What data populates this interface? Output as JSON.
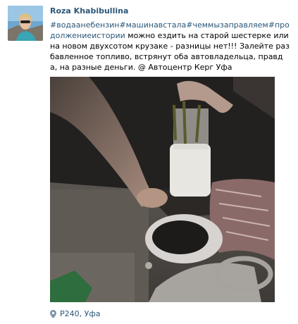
{
  "post": {
    "author": "Roza Khabibullina",
    "hashtags": "#водаанебензин#машинавстала#чеммызаправляем#продолжениеистории",
    "body": " можно ездить на старой шестерке или на новом двухсотом крузаке - разницы нет!!! Залейте разбавленное топливо, встрянут оба автовладельца, правда, на разные деньги. @ Автоцентр Керг Уфа",
    "location": "Р240, Уфа"
  },
  "colors": {
    "link": "#2b587a",
    "text": "#000000"
  },
  "icons": {
    "location": "map-pin-icon"
  }
}
